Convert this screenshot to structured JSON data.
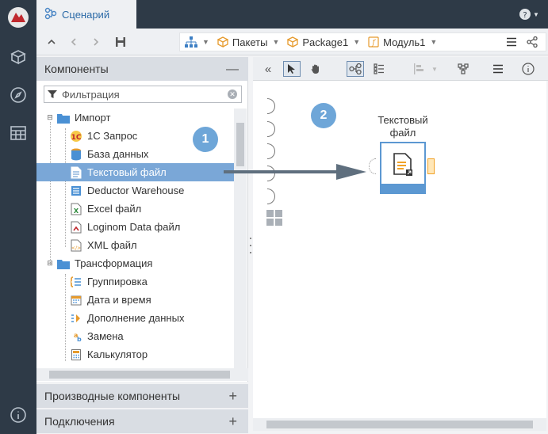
{
  "header": {
    "tab_title": "Сценарий",
    "help_icon": "question-circle-icon"
  },
  "toolbar": {
    "breadcrumb": [
      {
        "label": "",
        "icon": "hierarchy-icon"
      },
      {
        "label": "Пакеты",
        "icon": "package-icon"
      },
      {
        "label": "Package1",
        "icon": "package-icon"
      },
      {
        "label": "Модуль1",
        "icon": "module-icon"
      }
    ]
  },
  "components_panel": {
    "title": "Компоненты",
    "filter_placeholder": "Фильтрация",
    "groups": [
      {
        "label": "Импорт",
        "items": [
          {
            "label": "1С Запрос",
            "icon": "1c-query-icon"
          },
          {
            "label": "База данных",
            "icon": "database-icon"
          },
          {
            "label": "Текстовый файл",
            "icon": "text-file-icon",
            "selected": true
          },
          {
            "label": "Deductor Warehouse",
            "icon": "warehouse-icon"
          },
          {
            "label": "Excel файл",
            "icon": "excel-file-icon"
          },
          {
            "label": "Loginom Data файл",
            "icon": "loginom-data-file-icon"
          },
          {
            "label": "XML файл",
            "icon": "xml-file-icon"
          }
        ]
      },
      {
        "label": "Трансформация",
        "items": [
          {
            "label": "Группировка",
            "icon": "grouping-icon"
          },
          {
            "label": "Дата и время",
            "icon": "calendar-icon"
          },
          {
            "label": "Дополнение данных",
            "icon": "data-completion-icon"
          },
          {
            "label": "Замена",
            "icon": "replace-icon"
          },
          {
            "label": "Калькулятор",
            "icon": "calculator-icon"
          }
        ]
      }
    ]
  },
  "derived_panel": {
    "title": "Производные компоненты"
  },
  "connections_panel": {
    "title": "Подключения"
  },
  "canvas": {
    "badges": [
      "1",
      "2"
    ],
    "node": {
      "label_line1": "Текстовый",
      "label_line2": "файл"
    }
  },
  "colors": {
    "rail": "#2e3a47",
    "selection": "#7aa7d7",
    "badge": "#6ea6d8",
    "node_border": "#5c98d2",
    "output_port": "#f1a227",
    "arrow": "#5f6f7e"
  }
}
